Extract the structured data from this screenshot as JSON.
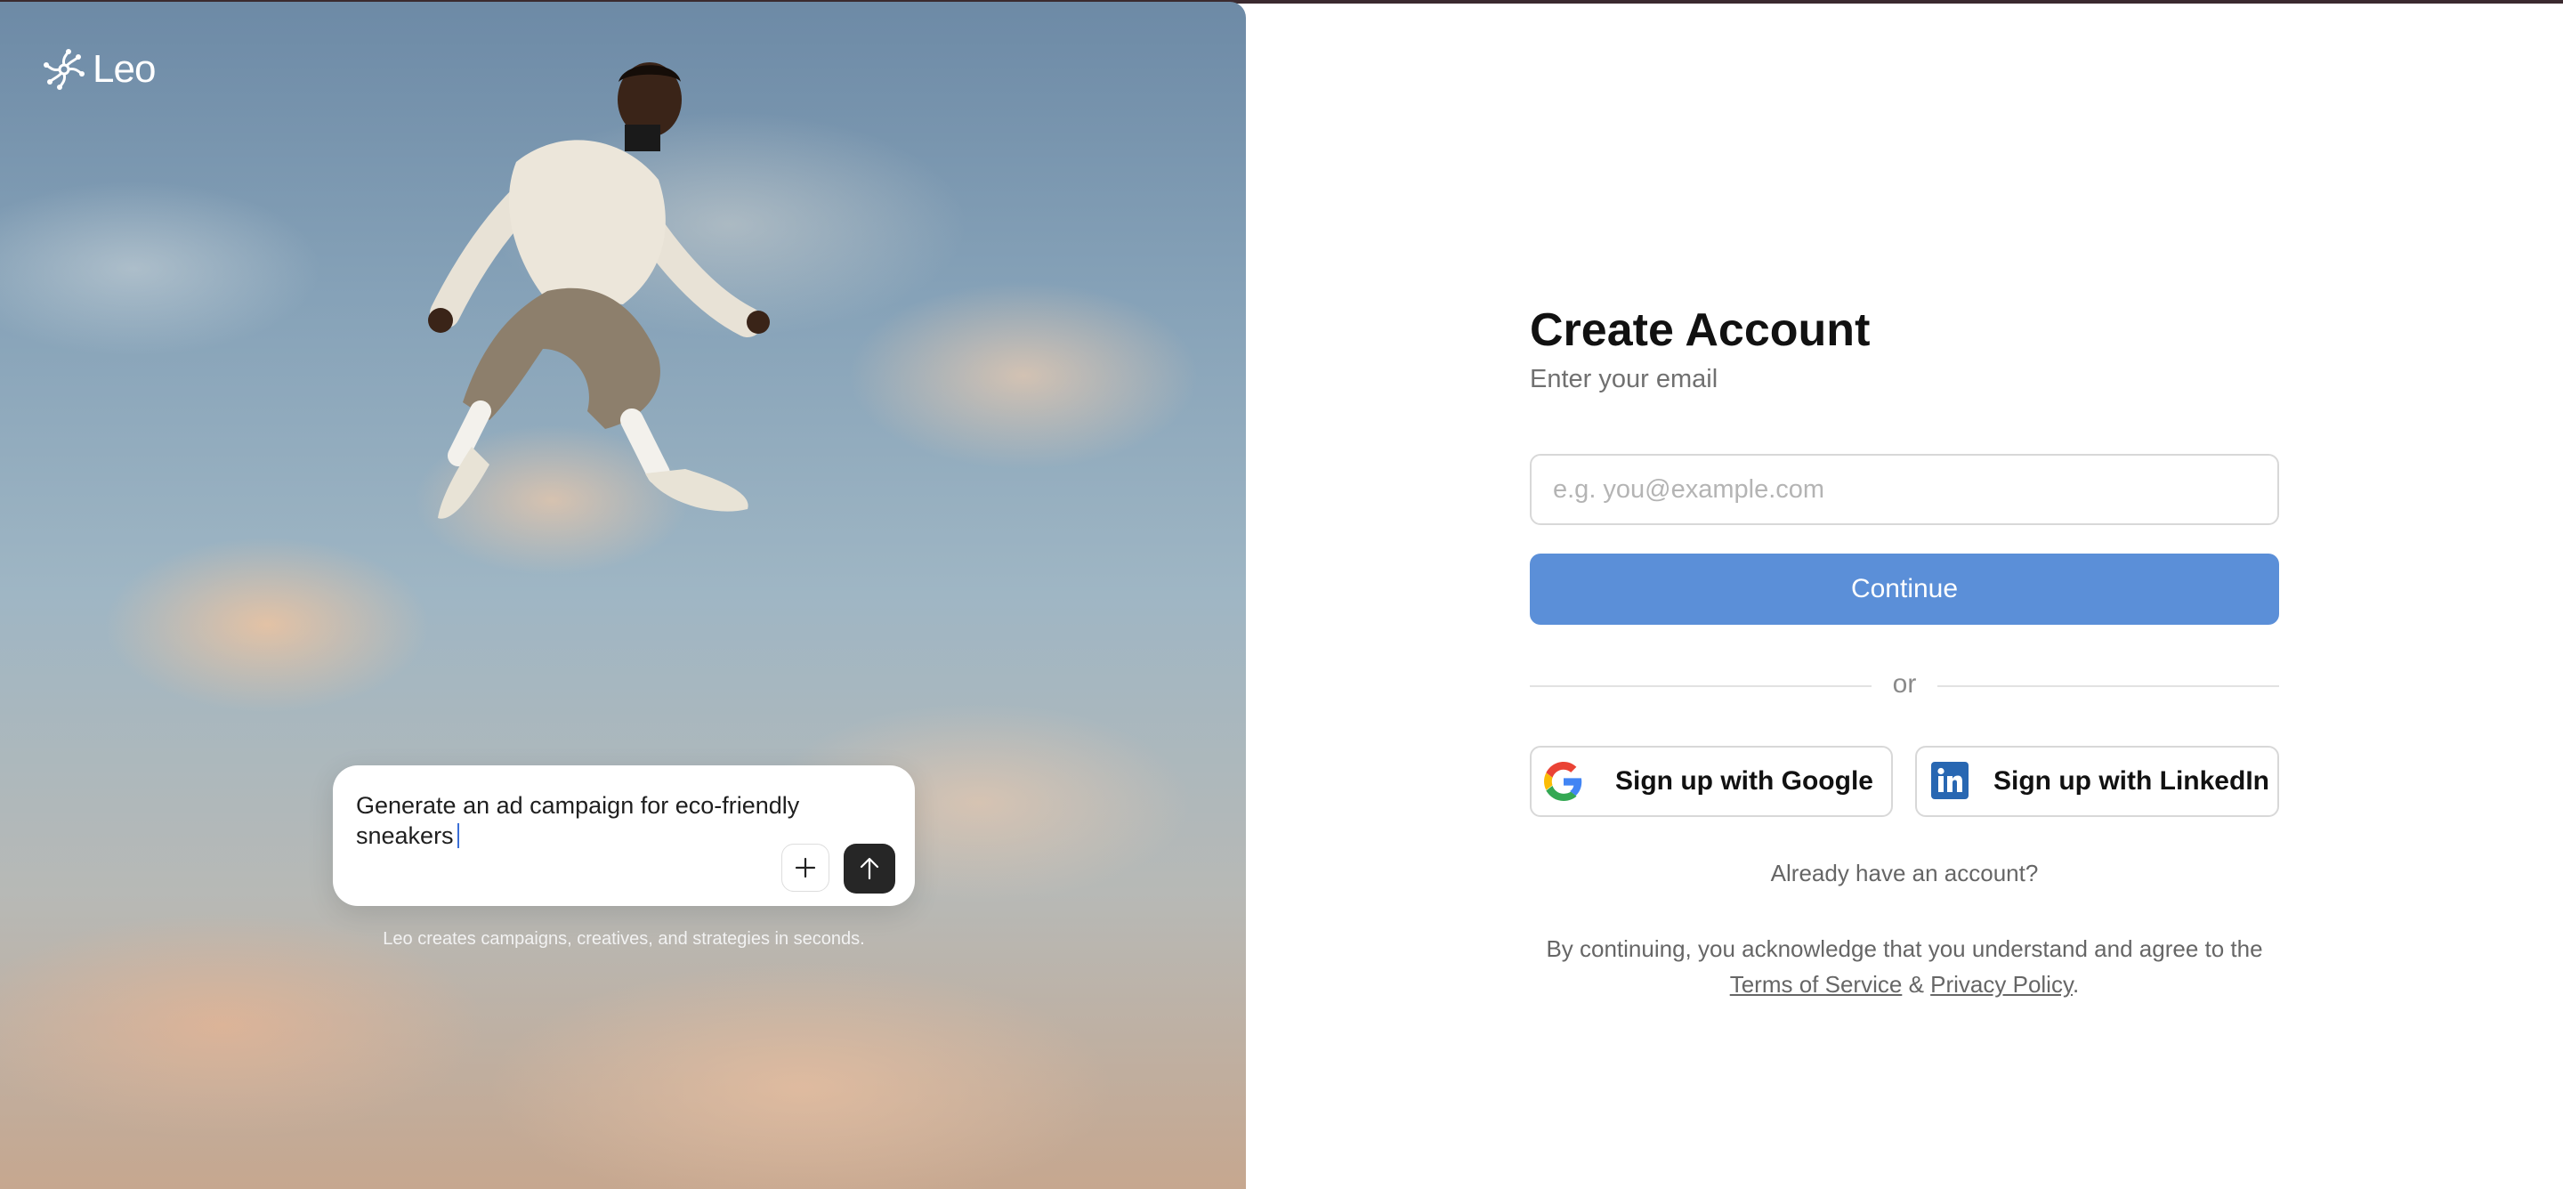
{
  "brand": {
    "name": "Leo"
  },
  "hero": {
    "prompt_text": "Generate an ad campaign for eco-friendly sneakers",
    "add_icon": "plus-icon",
    "send_icon": "arrow-up-icon",
    "caption": "Leo creates campaigns, creatives, and strategies in seconds."
  },
  "form": {
    "title": "Create Account",
    "subtitle": "Enter your email",
    "email_placeholder": "e.g. you@example.com",
    "continue_label": "Continue",
    "or_label": "or",
    "google_label": "Sign up with Google",
    "linkedin_label": "Sign up with LinkedIn",
    "already_label": "Already have an account?",
    "legal_prefix": "By continuing, you acknowledge that you understand and agree to the",
    "terms_label": "Terms of Service",
    "amp": "&",
    "privacy_label": "Privacy Policy",
    "period": "."
  },
  "colors": {
    "primary": "#5b8fd8",
    "send_button": "#262626",
    "linkedin": "#2867b2"
  }
}
